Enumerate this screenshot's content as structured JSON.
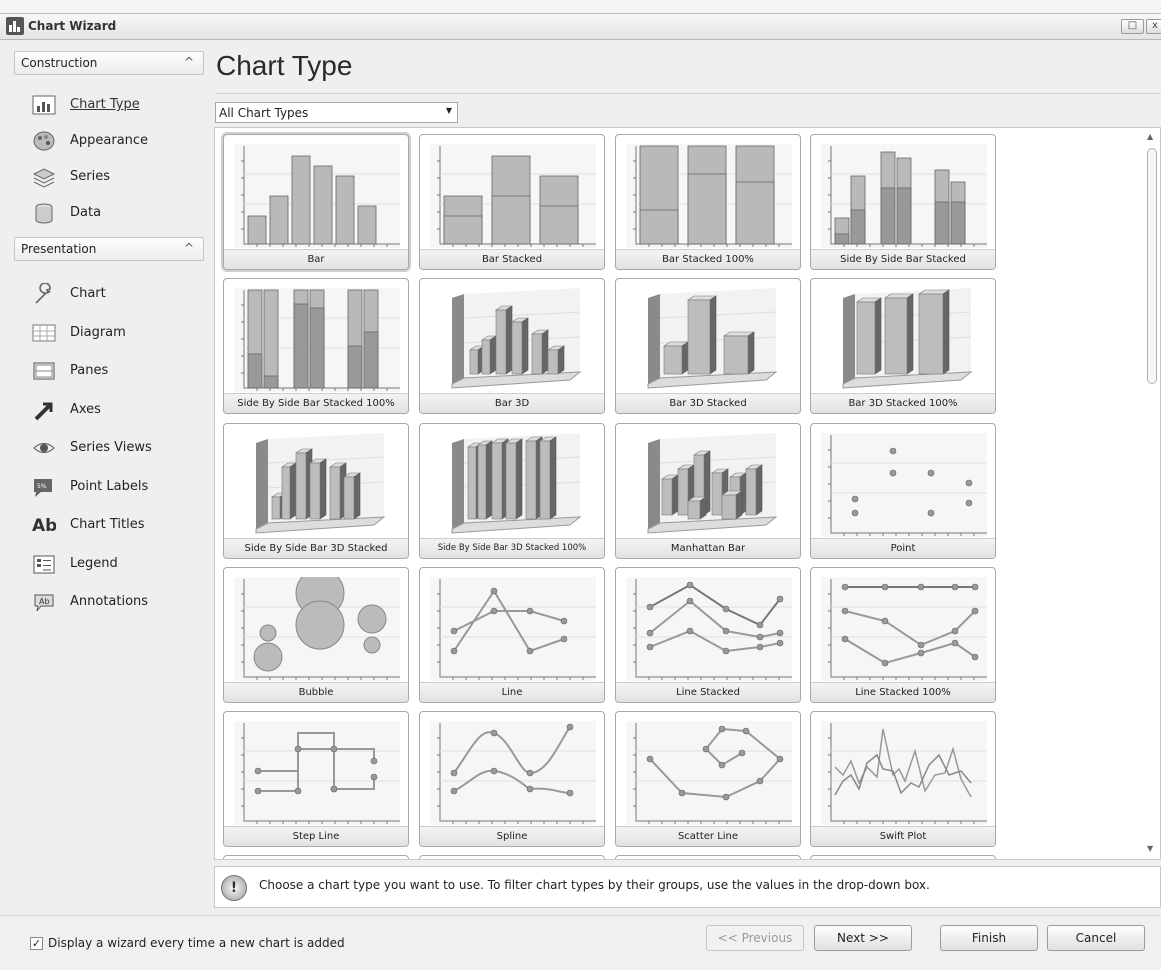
{
  "window": {
    "title": "Chart Wizard",
    "restore_label": "□",
    "close_label": "x"
  },
  "sidebar": {
    "groups": [
      {
        "title": "Construction",
        "chevron": "^"
      },
      {
        "title": "Presentation",
        "chevron": "^"
      }
    ],
    "construction_items": [
      {
        "label": "Chart Type",
        "icon": "bar-chart-icon",
        "selected": true
      },
      {
        "label": "Appearance",
        "icon": "palette-icon"
      },
      {
        "label": "Series",
        "icon": "series-icon"
      },
      {
        "label": "Data",
        "icon": "database-icon"
      }
    ],
    "presentation_items": [
      {
        "label": "Chart",
        "icon": "wrench-icon"
      },
      {
        "label": "Diagram",
        "icon": "diagram-icon"
      },
      {
        "label": "Panes",
        "icon": "panes-icon"
      },
      {
        "label": "Axes",
        "icon": "axes-arrow-icon"
      },
      {
        "label": "Series Views",
        "icon": "eye-icon"
      },
      {
        "label": "Point Labels",
        "icon": "point-label-icon"
      },
      {
        "label": "Chart Titles",
        "icon": "text-ab-icon"
      },
      {
        "label": "Legend",
        "icon": "legend-icon"
      },
      {
        "label": "Annotations",
        "icon": "annotation-icon"
      }
    ]
  },
  "main": {
    "heading": "Chart Type",
    "filter": {
      "value": "All Chart Types",
      "arrow": "▼"
    },
    "tiles": [
      {
        "label": "Bar",
        "kind": "bar"
      },
      {
        "label": "Bar Stacked",
        "kind": "barstacked"
      },
      {
        "label": "Bar Stacked 100%",
        "kind": "barstacked100"
      },
      {
        "label": "Side By Side Bar Stacked",
        "kind": "sbsstacked"
      },
      {
        "label": "Side By Side Bar Stacked 100%",
        "kind": "sbsstacked100"
      },
      {
        "label": "Bar 3D",
        "kind": "bar3d"
      },
      {
        "label": "Bar 3D Stacked",
        "kind": "bar3dstacked"
      },
      {
        "label": "Bar 3D Stacked 100%",
        "kind": "bar3dstacked100"
      },
      {
        "label": "Side By Side Bar 3D Stacked",
        "kind": "sbs3d"
      },
      {
        "label": "Side By Side Bar 3D Stacked 100%",
        "kind": "sbs3d100"
      },
      {
        "label": "Manhattan Bar",
        "kind": "manhattan"
      },
      {
        "label": "Point",
        "kind": "point"
      },
      {
        "label": "Bubble",
        "kind": "bubble"
      },
      {
        "label": "Line",
        "kind": "line"
      },
      {
        "label": "Line Stacked",
        "kind": "linestacked"
      },
      {
        "label": "Line Stacked 100%",
        "kind": "linestacked100"
      },
      {
        "label": "Step Line",
        "kind": "stepline"
      },
      {
        "label": "Spline",
        "kind": "spline"
      },
      {
        "label": "Scatter Line",
        "kind": "scatterline"
      },
      {
        "label": "Swift Plot",
        "kind": "swift"
      }
    ],
    "hint": {
      "icon_label": "!",
      "text": "Choose a chart type you want to use. To filter chart types by their groups, use the values in the drop-down box."
    }
  },
  "footer": {
    "checkbox_label": "Display a wizard every time a new chart is added",
    "checked": true,
    "check_mark": "✓",
    "buttons": {
      "previous": "<< Previous",
      "next": "Next >>",
      "finish": "Finish",
      "cancel": "Cancel"
    }
  }
}
